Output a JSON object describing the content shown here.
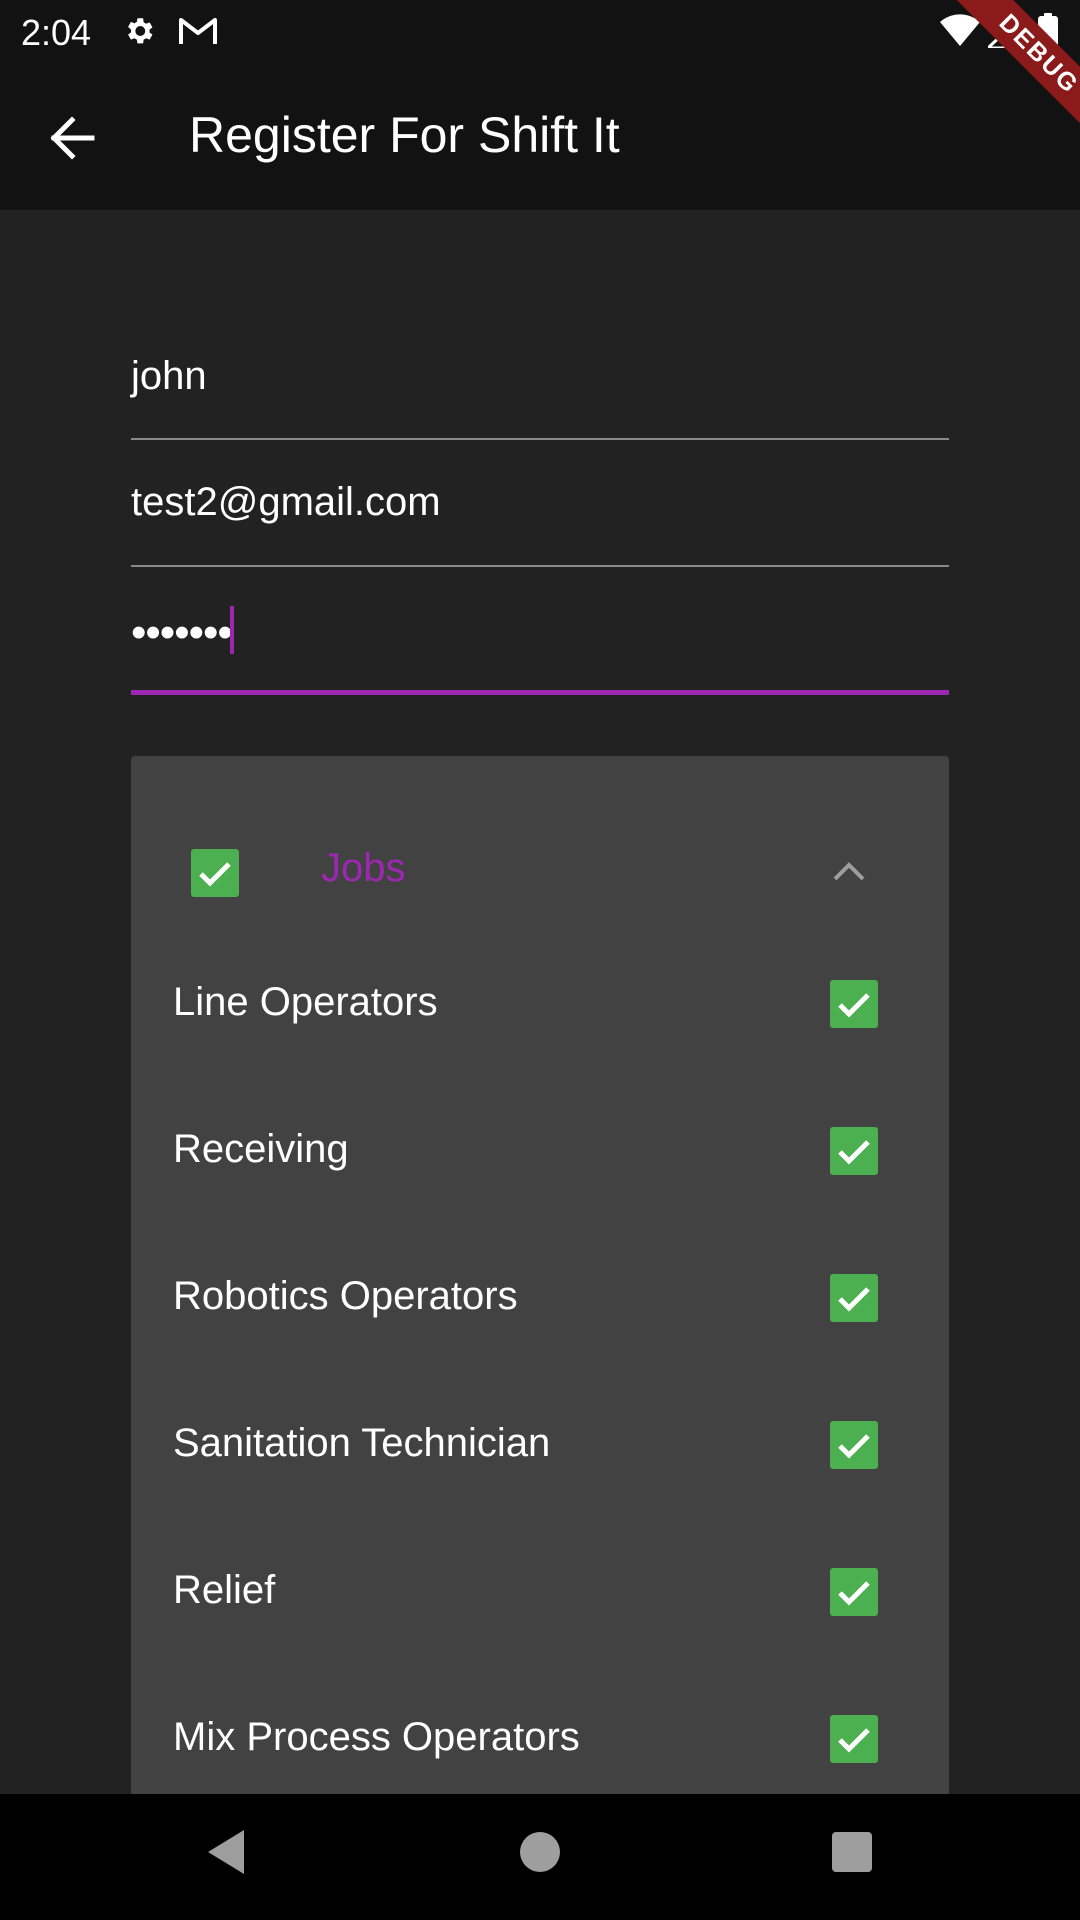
{
  "status_bar": {
    "time": "2:04",
    "icons": [
      "gear-icon",
      "gmail-icon",
      "wifi-icon",
      "signal-icon",
      "battery-icon"
    ]
  },
  "debug_banner": {
    "label": "DEBUG"
  },
  "app_bar": {
    "title": "Register For Shift It",
    "back_icon": "arrow-left-icon"
  },
  "form": {
    "name_value": "john",
    "email_value": "test2@gmail.com",
    "password_masked": "•••••••"
  },
  "jobs_panel": {
    "label": "Jobs",
    "all_checked": true,
    "expanded": true,
    "items": [
      {
        "label": "Line Operators",
        "checked": true
      },
      {
        "label": "Receiving",
        "checked": true
      },
      {
        "label": "Robotics Operators",
        "checked": true
      },
      {
        "label": "Sanitation Technician",
        "checked": true
      },
      {
        "label": "Relief",
        "checked": true
      },
      {
        "label": "Mix Process Operators",
        "checked": true
      }
    ]
  },
  "nav_bar": {
    "icons": [
      "nav-back-icon",
      "nav-home-icon",
      "nav-recents-icon"
    ]
  },
  "colors": {
    "accent": "#9c27b0",
    "checkbox": "#4caf50",
    "background": "#222222",
    "app_bar": "#121212",
    "panel": "#424242",
    "debug_banner": "#8b1a1a"
  }
}
